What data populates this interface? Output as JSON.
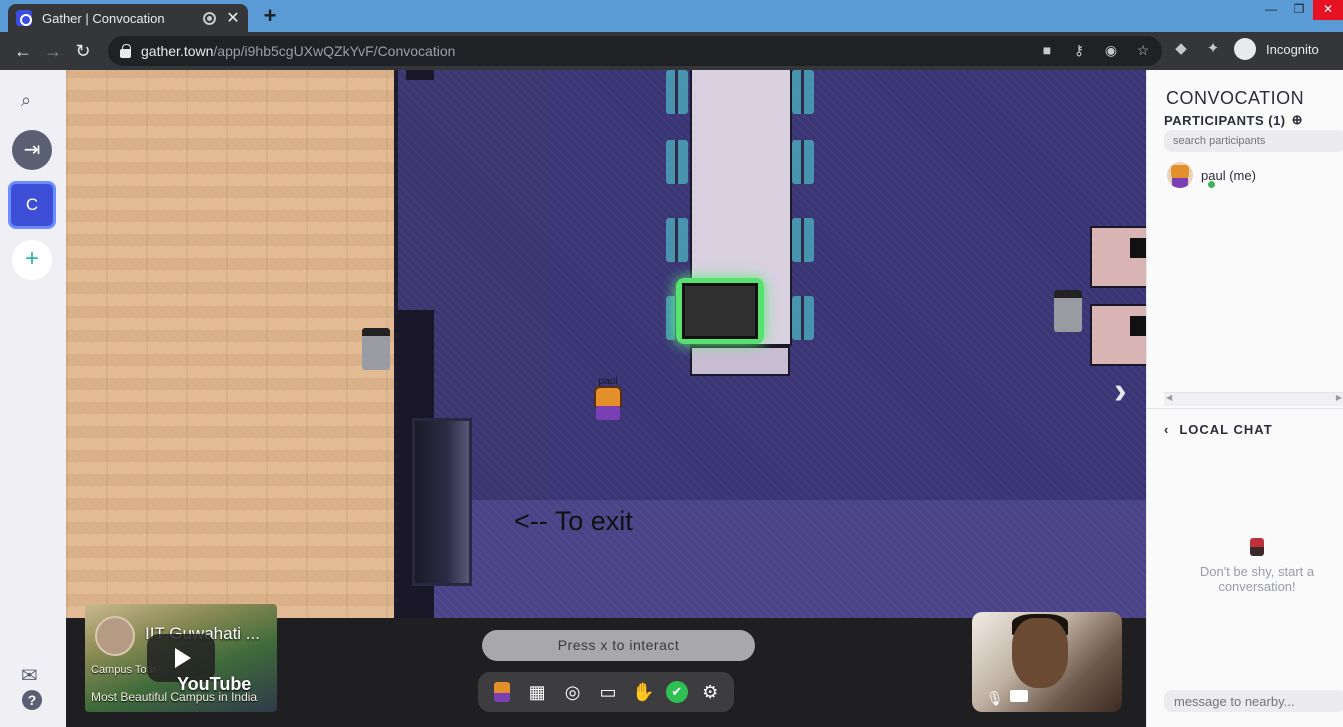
{
  "browser": {
    "tab_title": "Gather | Convocation",
    "new_tab_label": "+",
    "url_host": "gather.town",
    "url_path": "/app/i9hb5cgUXwQZkYvF/Convocation",
    "profile_label": "Incognito"
  },
  "rail": {
    "space_initial": "C",
    "add_label": "+"
  },
  "map": {
    "avatar_name": "paul",
    "exit_sign": "<-- To exit"
  },
  "bottom": {
    "youtube": {
      "title": "IIT Guwahati ...",
      "caption1": "Campus Tour",
      "caption2": "Most Beautiful Campus in India",
      "brand": "YouTube"
    },
    "interact_hint": "Press x to interact"
  },
  "panel": {
    "room_title": "CONVOCATION",
    "participants_label": "PARTICIPANTS (1)",
    "search_placeholder": "search participants",
    "participants": [
      {
        "name": "paul (me)",
        "status": "online"
      }
    ],
    "chat_title": "LOCAL CHAT",
    "empty_chat": "Don't be shy, start a conversation!",
    "message_placeholder": "message to nearby..."
  },
  "colors": {
    "accent": "#3d4fd6",
    "online": "#3db45a",
    "focus_glow": "#58e070"
  }
}
